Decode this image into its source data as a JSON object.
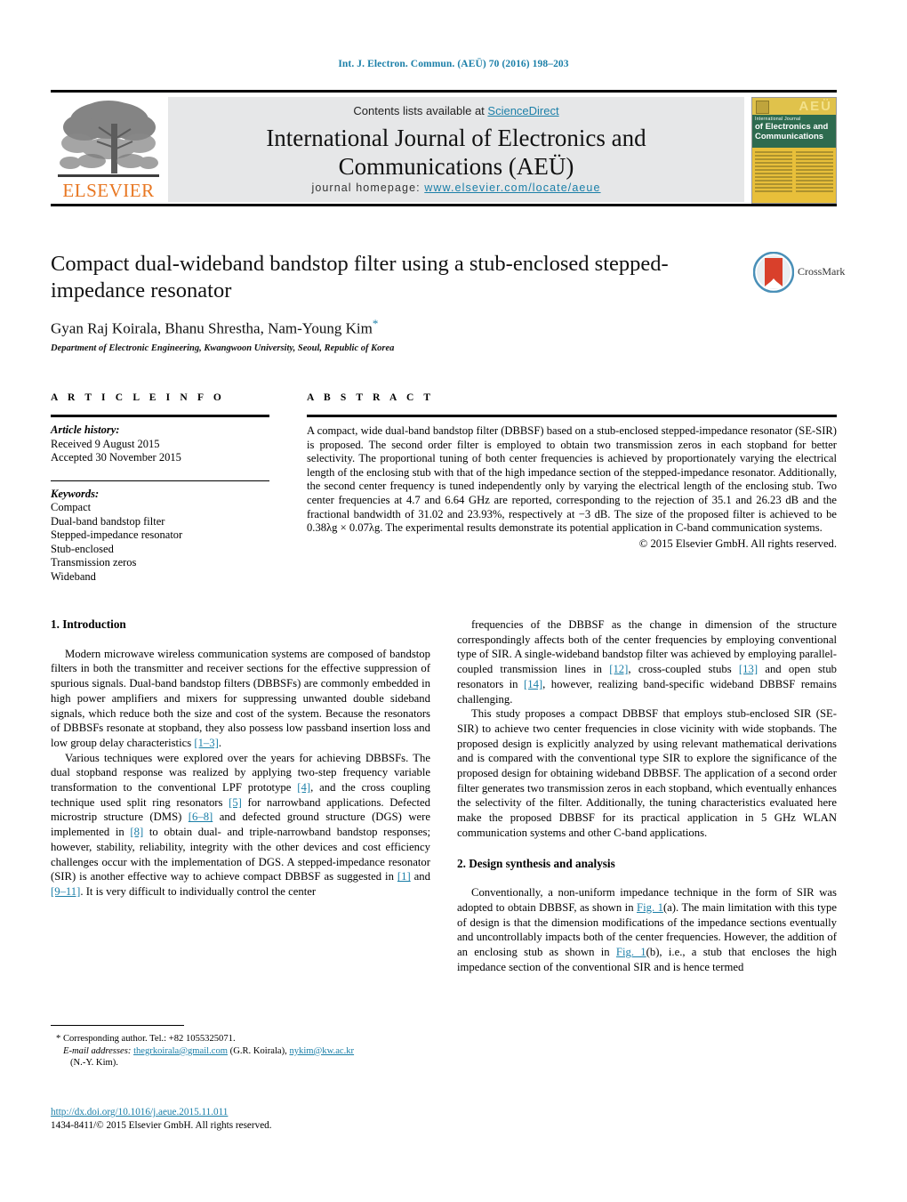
{
  "running_head": "Int. J. Electron. Commun. (AEÜ) 70 (2016) 198–203",
  "colors": {
    "link": "#1b7fa8",
    "elsevier_orange": "#e87722",
    "banner_grey": "#e6e7e8",
    "cover_gold": "#e8bf3a",
    "cover_green": "#2e6b4f"
  },
  "masthead": {
    "contents_prefix": "Contents lists available at ",
    "contents_link": "ScienceDirect",
    "journal_line1": "International Journal of Electronics and",
    "journal_line2": "Communications (AEÜ)",
    "homepage_label": "journal homepage:",
    "homepage_url": "www.elsevier.com/locate/aeue",
    "publisher_wordmark": "ELSEVIER",
    "cover": {
      "aeu": "AEÜ",
      "subtitle": "International Journal",
      "title_line1": "of Electronics and",
      "title_line2": "Communications"
    }
  },
  "crossmark": {
    "label": "CrossMark"
  },
  "article": {
    "title": "Compact dual-wideband bandstop filter using a stub-enclosed stepped-impedance resonator",
    "authors": "Gyan Raj Koirala, Bhanu Shrestha, Nam-Young Kim",
    "corresponding_marker": "*",
    "affiliation": "Department of Electronic Engineering, Kwangwoon University, Seoul, Republic of Korea"
  },
  "article_info": {
    "heading": "A R T I C L E   I N F O",
    "history_label": "Article history:",
    "received": "Received 9 August 2015",
    "accepted": "Accepted 30 November 2015",
    "keywords_label": "Keywords:",
    "keywords": [
      "Compact",
      "Dual-band bandstop filter",
      "Stepped-impedance resonator",
      "Stub-enclosed",
      "Transmission zeros",
      "Wideband"
    ]
  },
  "abstract": {
    "heading": "A B S T R A C T",
    "text": "A compact, wide dual-band bandstop filter (DBBSF) based on a stub-enclosed stepped-impedance resonator (SE-SIR) is proposed. The second order filter is employed to obtain two transmission zeros in each stopband for better selectivity. The proportional tuning of both center frequencies is achieved by proportionately varying the electrical length of the enclosing stub with that of the high impedance section of the stepped-impedance resonator. Additionally, the second center frequency is tuned independently only by varying the electrical length of the enclosing stub. Two center frequencies at 4.7 and 6.64 GHz are reported, corresponding to the rejection of 35.1 and 26.23 dB and the fractional bandwidth of 31.02 and 23.93%, respectively at −3 dB. The size of the proposed filter is achieved to be 0.38λg × 0.07λg. The experimental results demonstrate its potential application in C-band communication systems.",
    "copyright": "© 2015 Elsevier GmbH. All rights reserved."
  },
  "sections": {
    "intro_title": "1.  Introduction",
    "intro_p1_a": "Modern microwave wireless communication systems are composed of bandstop filters in both the transmitter and receiver sections for the effective suppression of spurious signals. Dual-band bandstop filters (DBBSFs) are commonly embedded in high power amplifiers and mixers for suppressing unwanted double sideband signals, which reduce both the size and cost of the system. Because the resonators of DBBSFs resonate at stopband, they also possess low passband insertion loss and low group delay characteristics ",
    "intro_p1_ref": "[1–3]",
    "intro_p1_b": ".",
    "intro_p2_a": "Various techniques were explored over the years for achieving DBBSFs. The dual stopband response was realized by applying two-step frequency variable transformation to the conventional LPF prototype ",
    "intro_p2_ref1": "[4]",
    "intro_p2_b": ", and the cross coupling technique used split ring resonators ",
    "intro_p2_ref2": "[5]",
    "intro_p2_c": " for narrowband applications. Defected microstrip structure (DMS) ",
    "intro_p2_ref3": "[6–8]",
    "intro_p2_d": " and defected ground structure (DGS) were implemented in ",
    "intro_p2_ref4": "[8]",
    "intro_p2_e": " to obtain dual- and triple-narrowband bandstop responses; however, stability, reliability, integrity with the other devices and cost efficiency challenges occur with the implementation of DGS. A stepped-impedance resonator (SIR) is another effective way to achieve compact DBBSF as suggested in ",
    "intro_p2_ref5": "[1]",
    "intro_p2_f": " and ",
    "intro_p2_ref6": "[9–11]",
    "intro_p2_g": ". It is very difficult to individually control the center",
    "right_p1_a": "frequencies of the DBBSF as the change in dimension of the structure correspondingly affects both of the center frequencies by employing conventional type of SIR. A single-wideband bandstop filter was achieved by employing parallel-coupled transmission lines in ",
    "right_p1_ref1": "[12]",
    "right_p1_b": ", cross-coupled stubs ",
    "right_p1_ref2": "[13]",
    "right_p1_c": " and open stub resonators in ",
    "right_p1_ref3": "[14]",
    "right_p1_d": ", however, realizing band-specific wideband DBBSF remains challenging.",
    "right_p2": "This study proposes a compact DBBSF that employs stub-enclosed SIR (SE-SIR) to achieve two center frequencies in close vicinity with wide stopbands. The proposed design is explicitly analyzed by using relevant mathematical derivations and is compared with the conventional type SIR to explore the significance of the proposed design for obtaining wideband DBBSF. The application of a second order filter generates two transmission zeros in each stopband, which eventually enhances the selectivity of the filter. Additionally, the tuning characteristics evaluated here make the proposed DBBSF for its practical application in 5 GHz WLAN communication systems and other C-band applications.",
    "design_title": "2.  Design synthesis and analysis",
    "design_p1_a": "Conventionally, a non-uniform impedance technique in the form of SIR was adopted to obtain DBBSF, as shown in ",
    "design_p1_fig1": "Fig. 1",
    "design_p1_b": "(a). The main limitation with this type of design is that the dimension modifications of the impedance sections eventually and uncontrollably impacts both of the center frequencies. However, the addition of an enclosing stub as shown in ",
    "design_p1_fig2": "Fig. 1",
    "design_p1_c": "(b), i.e., a stub that encloses the high impedance section of the conventional SIR and is hence termed"
  },
  "footnotes": {
    "corresponding": "* Corresponding author. Tel.: +82 1055325071.",
    "email_label": "E-mail addresses:",
    "email1": "thegrkoirala@gmail.com",
    "email1_owner": " (G.R. Koirala), ",
    "email2": "nykim@kw.ac.kr",
    "email2_owner": "(N.-Y. Kim).",
    "doi": "http://dx.doi.org/10.1016/j.aeue.2015.11.011",
    "issn_line": "1434-8411/© 2015 Elsevier GmbH. All rights reserved."
  }
}
